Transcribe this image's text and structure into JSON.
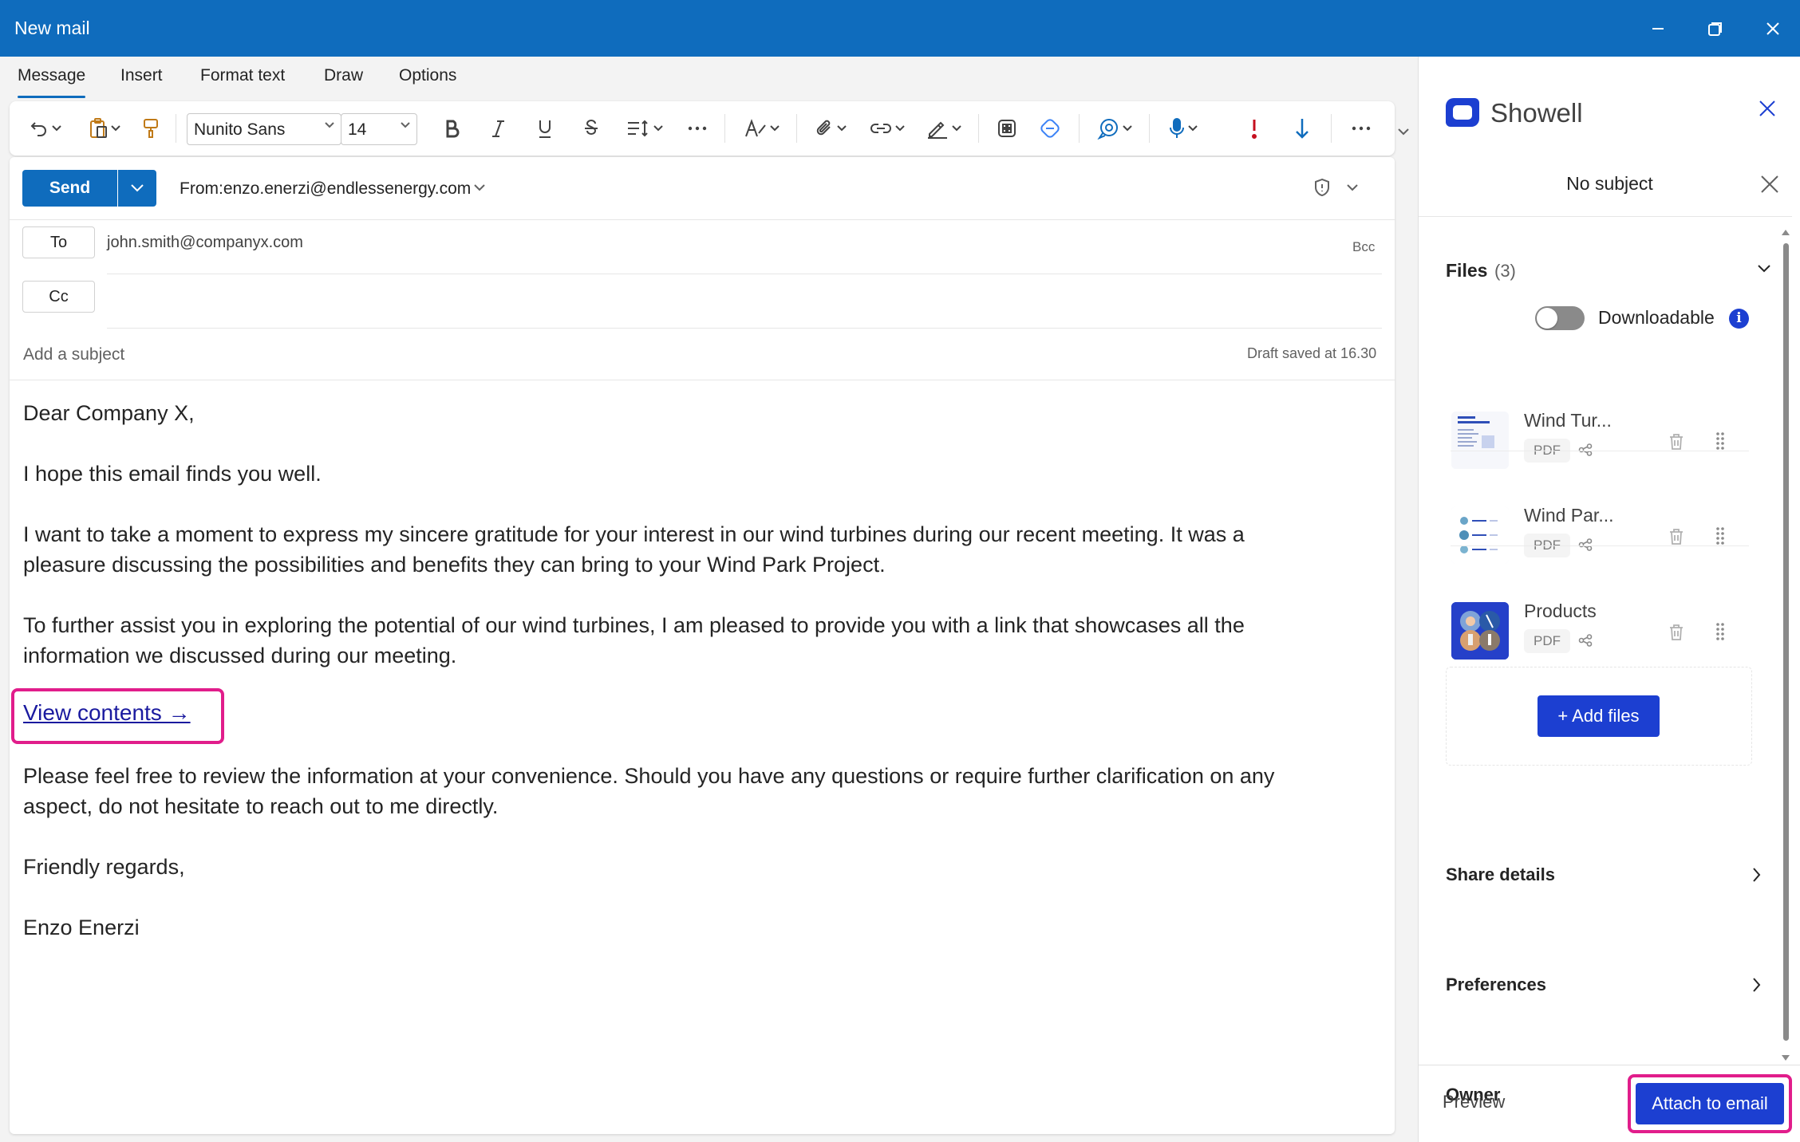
{
  "window": {
    "title": "New mail"
  },
  "tabs": [
    "Message",
    "Insert",
    "Format text",
    "Draw",
    "Options"
  ],
  "ribbon": {
    "font_name": "Nunito Sans",
    "font_size": "14"
  },
  "compose": {
    "send_label": "Send",
    "from_label": "From:",
    "from_email": "enzo.enerzi@endlessenergy.com",
    "to_label": "To",
    "to_value": "john.smith@companyx.com",
    "bcc_label": "Bcc",
    "cc_label": "Cc",
    "subject_placeholder": "Add a subject",
    "draft_status": "Draft saved at 16.30",
    "body": {
      "greeting": "Dear Company X,",
      "p1": "I hope this email finds you well.",
      "p2_l1": "I want to take a moment to express my sincere gratitude for your interest in our wind turbines during our recent meeting. It was a",
      "p2_l2": "pleasure discussing the possibilities and benefits they can bring to your Wind Park Project.",
      "p3_l1": "To further assist you in exploring the potential of our wind turbines, I am pleased to provide you with a link that showcases all the",
      "p3_l2": "information we discussed during our meeting.",
      "link": "View contents →",
      "p4_l1": "Please feel free to review the information at your convenience. Should you have any questions or require further clarification on any",
      "p4_l2": "aspect, do not hesitate to reach out to me directly.",
      "closing": "Friendly regards,",
      "signature": "Enzo Enerzi"
    }
  },
  "panel": {
    "brand": "Showell",
    "subject": "No subject",
    "files_label": "Files",
    "files_count": "(3)",
    "downloadable_label": "Downloadable",
    "info_glyph": "i",
    "files": [
      {
        "name": "Wind Tur...",
        "type": "PDF"
      },
      {
        "name": "Wind Par...",
        "type": "PDF"
      },
      {
        "name": "Products",
        "type": "PDF"
      }
    ],
    "add_files_label": "+ Add files",
    "sections": [
      "Share details",
      "Preferences",
      "Owner"
    ],
    "preview_label": "Preview",
    "attach_label": "Attach to email",
    "colors": {
      "accent": "#1c3fd1",
      "titlebar": "#0f6cbd",
      "highlight": "#e11d8b"
    }
  }
}
